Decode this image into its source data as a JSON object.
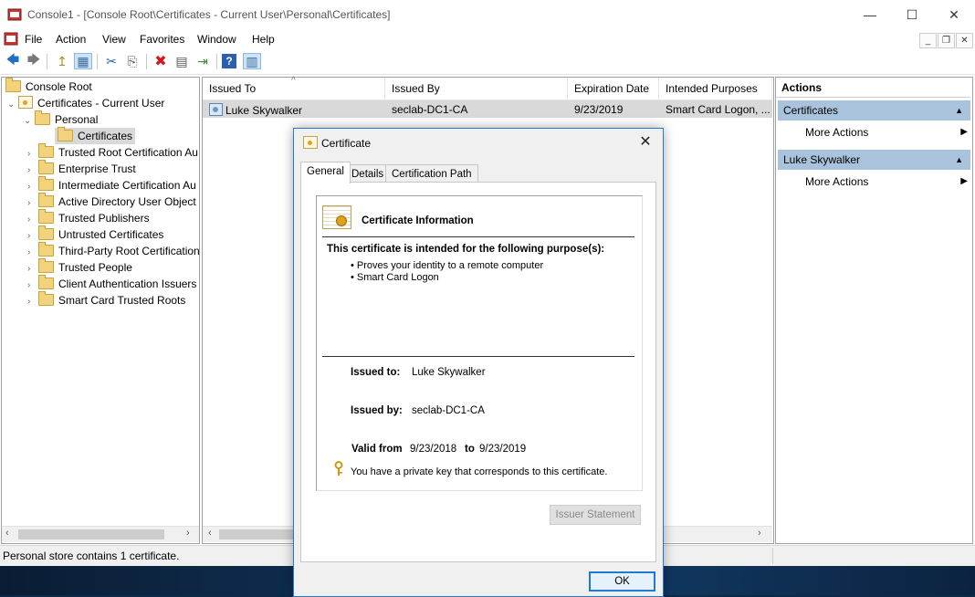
{
  "window": {
    "title": "Console1 - [Console Root\\Certificates - Current User\\Personal\\Certificates]",
    "minimize": "—",
    "maximize": "☐",
    "close": "✕"
  },
  "menu": [
    "File",
    "Action",
    "View",
    "Favorites",
    "Window",
    "Help"
  ],
  "mdi": {
    "minimize": "_",
    "restore": "❐",
    "close": "✕"
  },
  "toolbar": {
    "back": "🡄",
    "forward": "🡆",
    "up": "↥",
    "show_tree": "▦",
    "cut": "✂",
    "copy": "⎘",
    "delete": "✖",
    "properties": "▤",
    "export": "⇥",
    "help": "?",
    "show_action": "▥"
  },
  "tree": {
    "root": "Console Root",
    "store": "Certificates - Current User",
    "personal": "Personal",
    "certificates": "Certificates",
    "items": [
      "Trusted Root Certification Au",
      "Enterprise Trust",
      "Intermediate Certification Au",
      "Active Directory User Object",
      "Trusted Publishers",
      "Untrusted Certificates",
      "Third-Party Root Certification",
      "Trusted People",
      "Client Authentication Issuers",
      "Smart Card Trusted Roots"
    ]
  },
  "list": {
    "columns": [
      "Issued To",
      "Issued By",
      "Expiration Date",
      "Intended Purposes"
    ],
    "sort_indicator": "^",
    "rows": [
      {
        "issued_to": "Luke Skywalker",
        "issued_by": "seclab-DC1-CA",
        "expiration": "9/23/2019",
        "purposes": "Smart Card Logon, ..."
      }
    ]
  },
  "actions": {
    "title": "Actions",
    "section1": "Certificates",
    "section1_item": "More Actions",
    "section2": "Luke Skywalker",
    "section2_item": "More Actions"
  },
  "status": {
    "text": "Personal store contains 1 certificate."
  },
  "dialog": {
    "title": "Certificate",
    "tabs": [
      "General",
      "Details",
      "Certification Path"
    ],
    "heading": "Certificate Information",
    "purpose_intro": "This certificate is intended for the following purpose(s):",
    "purposes": [
      "Proves your identity to a remote computer",
      "Smart Card Logon"
    ],
    "issued_to_label": "Issued to:",
    "issued_to": "Luke Skywalker",
    "issued_by_label": "Issued by:",
    "issued_by": "seclab-DC1-CA",
    "valid_from_label": "Valid from",
    "valid_from": "9/23/2018",
    "to_label": "to",
    "valid_to": "9/23/2019",
    "key_note": "You have a private key that corresponds to this certificate.",
    "issuer_statement": "Issuer Statement",
    "ok": "OK"
  },
  "colors": {
    "accent": "#1f7ad0",
    "action_header": "#a9c3dc",
    "selection": "#d9d9d9"
  }
}
